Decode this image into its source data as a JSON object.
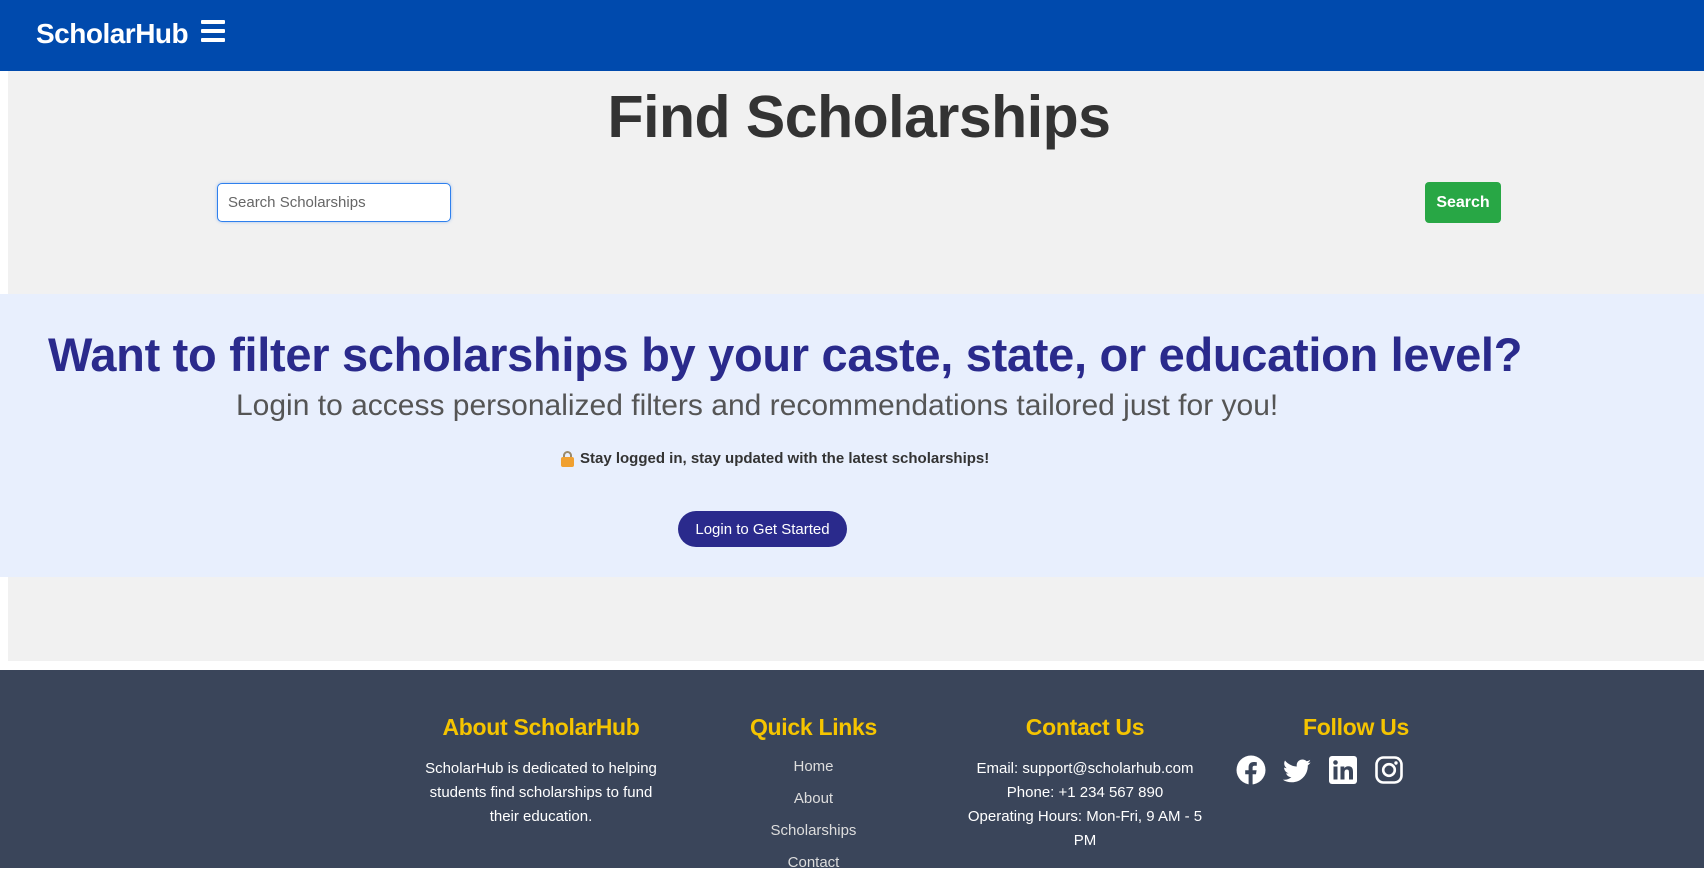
{
  "navbar": {
    "brand": "ScholarHub",
    "menu_icon": "hamburger-icon",
    "background_color": "#004aad"
  },
  "search_section": {
    "title": "Find Scholarships",
    "search_placeholder": "Search Scholarships",
    "search_value": "",
    "search_button_label": "Search",
    "search_button_color": "#28a745"
  },
  "promo": {
    "heading": "Want to filter scholarships by your caste, state, or education level?",
    "subheading": "Login to access personalized filters and recommendations tailored just for you!",
    "note_icon": "lock-icon",
    "note": "Stay logged in, stay updated with the latest scholarships!",
    "login_button_label": "Login to Get Started",
    "accent_color": "#2a2a8c"
  },
  "footer": {
    "about": {
      "title": "About ScholarHub",
      "text": "ScholarHub is dedicated to helping students find scholarships to fund their education."
    },
    "quick_links": {
      "title": "Quick Links",
      "items": [
        "Home",
        "About",
        "Scholarships",
        "Contact"
      ]
    },
    "contact": {
      "title": "Contact Us",
      "email": "Email: support@scholarhub.com",
      "phone": "Phone: +1 234 567 890",
      "hours": "Operating Hours: Mon-Fri, 9 AM - 5 PM"
    },
    "follow": {
      "title": "Follow Us",
      "icons": [
        "facebook-icon",
        "twitter-icon",
        "linkedin-icon",
        "instagram-icon"
      ]
    },
    "heading_color": "#f5c400",
    "background_color": "#3a455a"
  }
}
